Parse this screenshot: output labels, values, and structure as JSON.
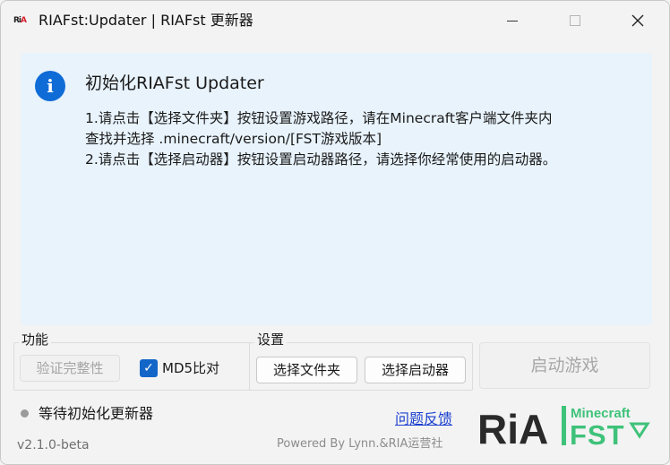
{
  "window": {
    "title": "RIAFst:Updater | RIAFst 更新器",
    "app_logo_text": "RiA"
  },
  "info": {
    "title": "初始化RIAFst Updater",
    "lines": [
      "1.请点击【选择文件夹】按钮设置游戏路径，请在Minecraft客户端文件夹内",
      "查找并选择 .minecraft/version/[FST游戏版本]",
      "2.请点击【选择启动器】按钮设置启动器路径，请选择你经常使用的启动器。"
    ]
  },
  "function_group": {
    "label": "功能",
    "verify_button": "验证完整性",
    "md5_label": "MD5比对",
    "md5_checked": true
  },
  "settings_group": {
    "label": "设置",
    "folder_button": "选择文件夹",
    "launcher_button": "选择启动器"
  },
  "start_button": "启动游戏",
  "status": "等待初始化更新器",
  "feedback_link": "问题反馈",
  "version": "v2.1.0-beta",
  "powered_by": "Powered By Lynn.&RIA运营社",
  "brand": {
    "ria_text": "RiA",
    "minecraft_text": "Minecraft",
    "fst_text": "FST",
    "colors": {
      "dark": "#2a2a2a",
      "red": "#d6202c",
      "green": "#3fc27a"
    }
  },
  "colors": {
    "accent": "#0f6cd6",
    "info_bg": "#e8f3fc",
    "link": "#1a3fcf"
  }
}
